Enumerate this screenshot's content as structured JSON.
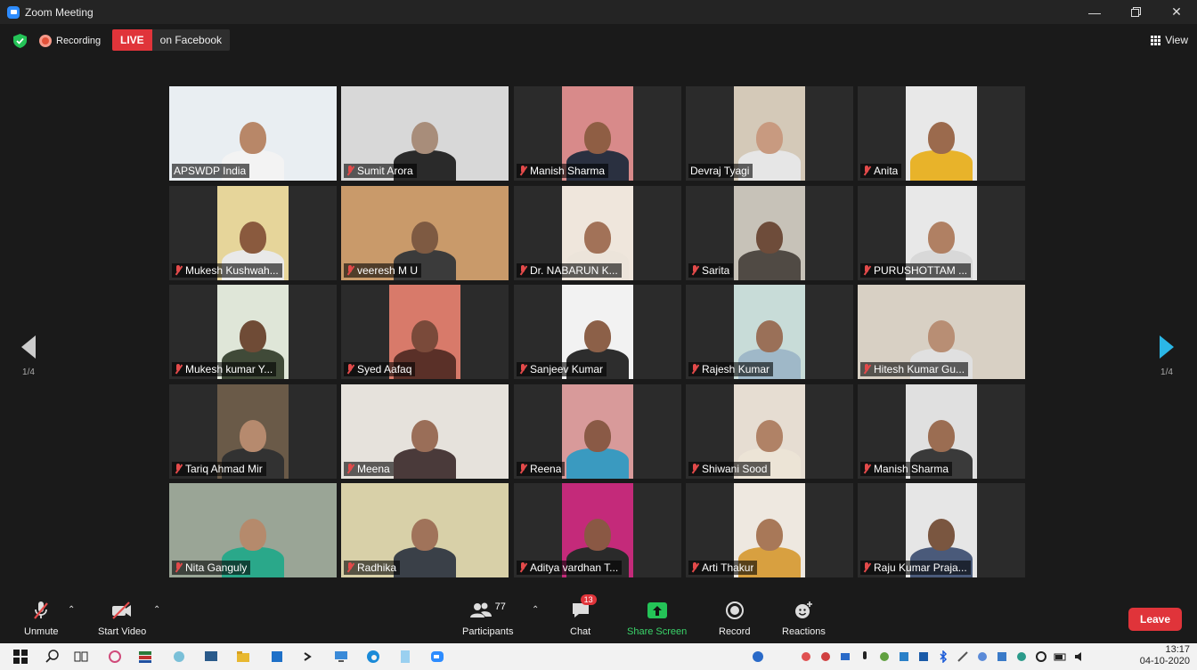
{
  "window": {
    "title": "Zoom Meeting"
  },
  "infobar": {
    "recording_label": "Recording",
    "live_label": "LIVE",
    "live_destination": "on Facebook",
    "view_label": "View"
  },
  "pagination": {
    "left": "1/4",
    "right": "1/4"
  },
  "participants": [
    {
      "name": "APSWDP India",
      "muted": false,
      "active": true,
      "bg": "#e9eef2",
      "skin": "#b88768",
      "shirt": "#f3f3f3"
    },
    {
      "name": "Sumit Arora",
      "muted": true,
      "active": false,
      "bg": "#d8d8d8",
      "skin": "#a88d7a",
      "shirt": "#2a2a2a"
    },
    {
      "name": "Manish Sharma",
      "muted": true,
      "active": false,
      "bg": "#d88a8a",
      "skin": "#8f5e44",
      "shirt": "#2a3040"
    },
    {
      "name": "Devraj Tyagi",
      "muted": false,
      "active": false,
      "bg": "#d4c9b8",
      "skin": "#c89a80",
      "shirt": "#e6e6e6"
    },
    {
      "name": "Anita",
      "muted": true,
      "active": false,
      "bg": "#e8e8e8",
      "skin": "#9b6a4d",
      "shirt": "#e8b32a"
    },
    {
      "name": "Mukesh Kushwah...",
      "muted": true,
      "active": false,
      "bg": "#e6d59a",
      "skin": "#8a5a3e",
      "shirt": "#e9e9e9"
    },
    {
      "name": "veeresh M U",
      "muted": true,
      "active": false,
      "bg": "#c99a6a",
      "skin": "#7e5a42",
      "shirt": "#3b3b3b"
    },
    {
      "name": "Dr. NABARUN K...",
      "muted": true,
      "active": false,
      "bg": "#efe6dc",
      "skin": "#a27258",
      "shirt": "#ece4da"
    },
    {
      "name": "Sarita",
      "muted": true,
      "active": false,
      "bg": "#c7c2b8",
      "skin": "#6e4c3a",
      "shirt": "#504a44"
    },
    {
      "name": "PURUSHOTTAM ...",
      "muted": true,
      "active": false,
      "bg": "#e8e8e8",
      "skin": "#b08063",
      "shirt": "#d8d8d8"
    },
    {
      "name": "Mukesh kumar Y...",
      "muted": true,
      "active": false,
      "bg": "#dfe6d8",
      "skin": "#6f4b36",
      "shirt": "#404a38"
    },
    {
      "name": "Syed Aafaq",
      "muted": true,
      "active": false,
      "bg": "#d87a6a",
      "skin": "#7a4a3a",
      "shirt": "#5a3028"
    },
    {
      "name": "Sanjeev Kumar",
      "muted": true,
      "active": false,
      "bg": "#f2f2f2",
      "skin": "#8c6048",
      "shirt": "#2d2d2d"
    },
    {
      "name": "Rajesh Kumar",
      "muted": true,
      "active": false,
      "bg": "#c8dcd8",
      "skin": "#9a7058",
      "shirt": "#9fb8c8"
    },
    {
      "name": "Hitesh Kumar Gu...",
      "muted": true,
      "active": false,
      "bg": "#d8d0c4",
      "skin": "#b88e74",
      "shirt": "#e0e0e0"
    },
    {
      "name": "Tariq Ahmad Mir",
      "muted": true,
      "active": false,
      "bg": "#6a5a48",
      "skin": "#b68a6e",
      "shirt": "#323232"
    },
    {
      "name": "Meena",
      "muted": true,
      "active": false,
      "bg": "#e6e2dc",
      "skin": "#9a6e58",
      "shirt": "#4a3a3a"
    },
    {
      "name": "Reena",
      "muted": true,
      "active": false,
      "bg": "#d89a9a",
      "skin": "#8a5a46",
      "shirt": "#3a9ac0"
    },
    {
      "name": "Shiwani Sood",
      "muted": true,
      "active": false,
      "bg": "#e6ddd2",
      "skin": "#b08266",
      "shirt": "#ece4d6"
    },
    {
      "name": "Manish Sharma",
      "muted": true,
      "active": false,
      "bg": "#e0e0e0",
      "skin": "#9b6d52",
      "shirt": "#3a3a3a"
    },
    {
      "name": "Nita Ganguly",
      "muted": true,
      "active": false,
      "bg": "#9aa596",
      "skin": "#b58a6c",
      "shirt": "#2aa88a"
    },
    {
      "name": "Radhika",
      "muted": true,
      "active": false,
      "bg": "#d8d0a8",
      "skin": "#a0735a",
      "shirt": "#3a4048"
    },
    {
      "name": "Aditya vardhan T...",
      "muted": true,
      "active": false,
      "bg": "#c42a7a",
      "skin": "#8a5844",
      "shirt": "#2a2a2a"
    },
    {
      "name": "Arti Thakur",
      "muted": true,
      "active": false,
      "bg": "#eee8e0",
      "skin": "#a87858",
      "shirt": "#d8a040"
    },
    {
      "name": "Raju Kumar Praja...",
      "muted": true,
      "active": false,
      "bg": "#e6e6e6",
      "skin": "#7a5640",
      "shirt": "#4a5a7a"
    }
  ],
  "toolbar": {
    "unmute": "Unmute",
    "start_video": "Start Video",
    "participants": "Participants",
    "participants_count": "77",
    "chat": "Chat",
    "chat_badge": "13",
    "share_screen": "Share Screen",
    "record": "Record",
    "reactions": "Reactions",
    "leave": "Leave"
  },
  "taskbar": {
    "time": "13:17",
    "date": "04-10-2020"
  },
  "colors": {
    "live": "#e0343a",
    "share": "#24c357",
    "active_speaker": "#f3f08d",
    "next_arrow": "#2bb7e6"
  }
}
